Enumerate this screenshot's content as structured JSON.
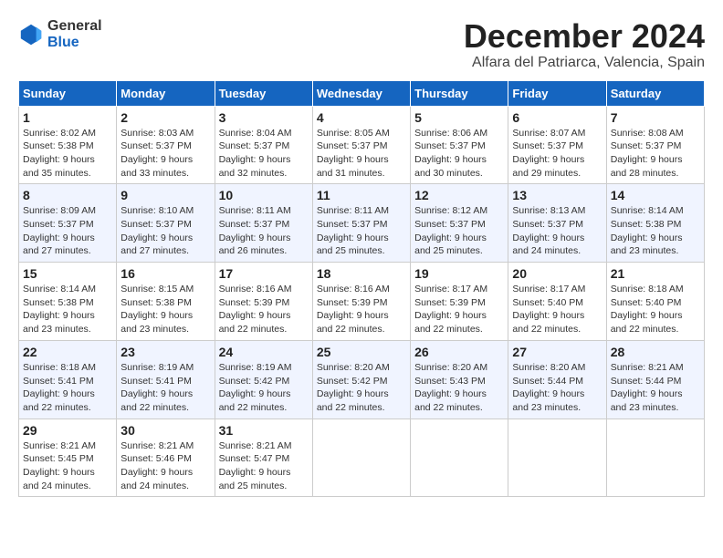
{
  "logo": {
    "general": "General",
    "blue": "Blue"
  },
  "title": "December 2024",
  "location": "Alfara del Patriarca, Valencia, Spain",
  "headers": [
    "Sunday",
    "Monday",
    "Tuesday",
    "Wednesday",
    "Thursday",
    "Friday",
    "Saturday"
  ],
  "weeks": [
    [
      {
        "day": "1",
        "sunrise": "Sunrise: 8:02 AM",
        "sunset": "Sunset: 5:38 PM",
        "daylight": "Daylight: 9 hours and 35 minutes."
      },
      {
        "day": "2",
        "sunrise": "Sunrise: 8:03 AM",
        "sunset": "Sunset: 5:37 PM",
        "daylight": "Daylight: 9 hours and 33 minutes."
      },
      {
        "day": "3",
        "sunrise": "Sunrise: 8:04 AM",
        "sunset": "Sunset: 5:37 PM",
        "daylight": "Daylight: 9 hours and 32 minutes."
      },
      {
        "day": "4",
        "sunrise": "Sunrise: 8:05 AM",
        "sunset": "Sunset: 5:37 PM",
        "daylight": "Daylight: 9 hours and 31 minutes."
      },
      {
        "day": "5",
        "sunrise": "Sunrise: 8:06 AM",
        "sunset": "Sunset: 5:37 PM",
        "daylight": "Daylight: 9 hours and 30 minutes."
      },
      {
        "day": "6",
        "sunrise": "Sunrise: 8:07 AM",
        "sunset": "Sunset: 5:37 PM",
        "daylight": "Daylight: 9 hours and 29 minutes."
      },
      {
        "day": "7",
        "sunrise": "Sunrise: 8:08 AM",
        "sunset": "Sunset: 5:37 PM",
        "daylight": "Daylight: 9 hours and 28 minutes."
      }
    ],
    [
      {
        "day": "8",
        "sunrise": "Sunrise: 8:09 AM",
        "sunset": "Sunset: 5:37 PM",
        "daylight": "Daylight: 9 hours and 27 minutes."
      },
      {
        "day": "9",
        "sunrise": "Sunrise: 8:10 AM",
        "sunset": "Sunset: 5:37 PM",
        "daylight": "Daylight: 9 hours and 27 minutes."
      },
      {
        "day": "10",
        "sunrise": "Sunrise: 8:11 AM",
        "sunset": "Sunset: 5:37 PM",
        "daylight": "Daylight: 9 hours and 26 minutes."
      },
      {
        "day": "11",
        "sunrise": "Sunrise: 8:11 AM",
        "sunset": "Sunset: 5:37 PM",
        "daylight": "Daylight: 9 hours and 25 minutes."
      },
      {
        "day": "12",
        "sunrise": "Sunrise: 8:12 AM",
        "sunset": "Sunset: 5:37 PM",
        "daylight": "Daylight: 9 hours and 25 minutes."
      },
      {
        "day": "13",
        "sunrise": "Sunrise: 8:13 AM",
        "sunset": "Sunset: 5:37 PM",
        "daylight": "Daylight: 9 hours and 24 minutes."
      },
      {
        "day": "14",
        "sunrise": "Sunrise: 8:14 AM",
        "sunset": "Sunset: 5:38 PM",
        "daylight": "Daylight: 9 hours and 23 minutes."
      }
    ],
    [
      {
        "day": "15",
        "sunrise": "Sunrise: 8:14 AM",
        "sunset": "Sunset: 5:38 PM",
        "daylight": "Daylight: 9 hours and 23 minutes."
      },
      {
        "day": "16",
        "sunrise": "Sunrise: 8:15 AM",
        "sunset": "Sunset: 5:38 PM",
        "daylight": "Daylight: 9 hours and 23 minutes."
      },
      {
        "day": "17",
        "sunrise": "Sunrise: 8:16 AM",
        "sunset": "Sunset: 5:39 PM",
        "daylight": "Daylight: 9 hours and 22 minutes."
      },
      {
        "day": "18",
        "sunrise": "Sunrise: 8:16 AM",
        "sunset": "Sunset: 5:39 PM",
        "daylight": "Daylight: 9 hours and 22 minutes."
      },
      {
        "day": "19",
        "sunrise": "Sunrise: 8:17 AM",
        "sunset": "Sunset: 5:39 PM",
        "daylight": "Daylight: 9 hours and 22 minutes."
      },
      {
        "day": "20",
        "sunrise": "Sunrise: 8:17 AM",
        "sunset": "Sunset: 5:40 PM",
        "daylight": "Daylight: 9 hours and 22 minutes."
      },
      {
        "day": "21",
        "sunrise": "Sunrise: 8:18 AM",
        "sunset": "Sunset: 5:40 PM",
        "daylight": "Daylight: 9 hours and 22 minutes."
      }
    ],
    [
      {
        "day": "22",
        "sunrise": "Sunrise: 8:18 AM",
        "sunset": "Sunset: 5:41 PM",
        "daylight": "Daylight: 9 hours and 22 minutes."
      },
      {
        "day": "23",
        "sunrise": "Sunrise: 8:19 AM",
        "sunset": "Sunset: 5:41 PM",
        "daylight": "Daylight: 9 hours and 22 minutes."
      },
      {
        "day": "24",
        "sunrise": "Sunrise: 8:19 AM",
        "sunset": "Sunset: 5:42 PM",
        "daylight": "Daylight: 9 hours and 22 minutes."
      },
      {
        "day": "25",
        "sunrise": "Sunrise: 8:20 AM",
        "sunset": "Sunset: 5:42 PM",
        "daylight": "Daylight: 9 hours and 22 minutes."
      },
      {
        "day": "26",
        "sunrise": "Sunrise: 8:20 AM",
        "sunset": "Sunset: 5:43 PM",
        "daylight": "Daylight: 9 hours and 22 minutes."
      },
      {
        "day": "27",
        "sunrise": "Sunrise: 8:20 AM",
        "sunset": "Sunset: 5:44 PM",
        "daylight": "Daylight: 9 hours and 23 minutes."
      },
      {
        "day": "28",
        "sunrise": "Sunrise: 8:21 AM",
        "sunset": "Sunset: 5:44 PM",
        "daylight": "Daylight: 9 hours and 23 minutes."
      }
    ],
    [
      {
        "day": "29",
        "sunrise": "Sunrise: 8:21 AM",
        "sunset": "Sunset: 5:45 PM",
        "daylight": "Daylight: 9 hours and 24 minutes."
      },
      {
        "day": "30",
        "sunrise": "Sunrise: 8:21 AM",
        "sunset": "Sunset: 5:46 PM",
        "daylight": "Daylight: 9 hours and 24 minutes."
      },
      {
        "day": "31",
        "sunrise": "Sunrise: 8:21 AM",
        "sunset": "Sunset: 5:47 PM",
        "daylight": "Daylight: 9 hours and 25 minutes."
      },
      null,
      null,
      null,
      null
    ]
  ]
}
